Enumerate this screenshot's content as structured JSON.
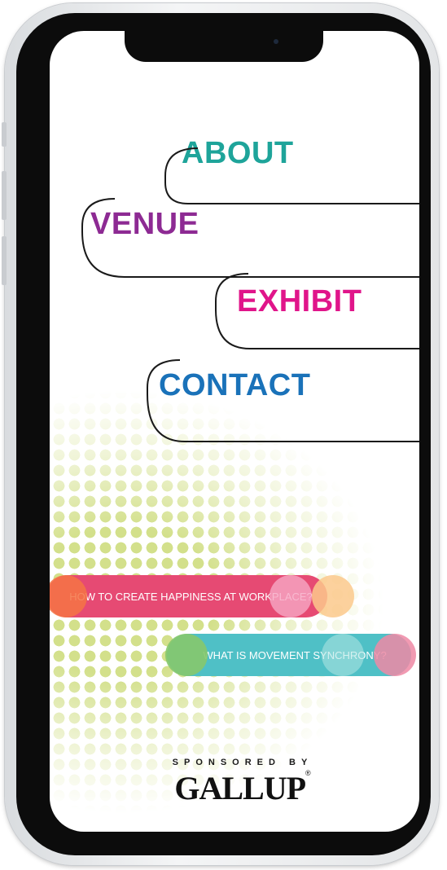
{
  "nav": {
    "about": "ABOUT",
    "venue": "VENUE",
    "exhibit": "EXHIBIT",
    "contact": "CONTACT"
  },
  "pills": {
    "happiness": "HOW TO CREATE HAPPINESS AT WORKPLACE?",
    "synchrony": "WHAT IS MOVEMENT SYNCHRONY?"
  },
  "sponsor": {
    "caption": "SPONSORED BY",
    "brand": "GALLUP",
    "mark": "®"
  },
  "colors": {
    "about": "#1ea49a",
    "venue": "#8d2a93",
    "exhibit": "#e0158a",
    "contact": "#1a72b9",
    "pill_pink": "#e64a73",
    "pill_teal": "#4fc0c6",
    "dots": "#d3e08b"
  }
}
